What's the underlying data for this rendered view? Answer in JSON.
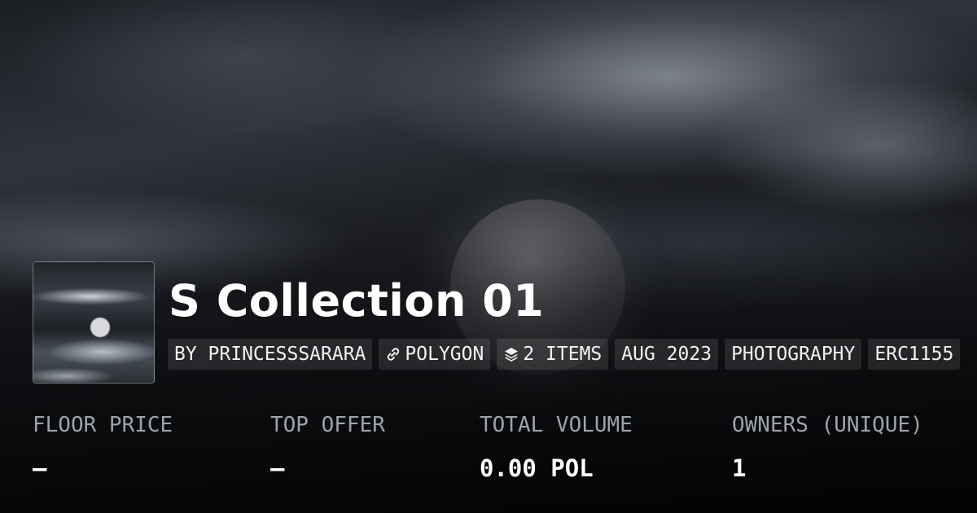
{
  "collection": {
    "title": "S Collection 01",
    "tags": {
      "creator": "BY PRINCESSSARARA",
      "chain": "POLYGON",
      "items": "2 ITEMS",
      "date": "AUG 2023",
      "category": "PHOTOGRAPHY",
      "standard": "ERC1155"
    },
    "icons": {
      "chain": "link-icon",
      "items": "layers-icon"
    }
  },
  "stats": {
    "floor_price": {
      "label": "FLOOR PRICE",
      "value": "–"
    },
    "top_offer": {
      "label": "TOP OFFER",
      "value": "–"
    },
    "total_volume": {
      "label": "TOTAL VOLUME",
      "value": "0.00 POL"
    },
    "owners": {
      "label": "OWNERS (UNIQUE)",
      "value": "1"
    }
  }
}
